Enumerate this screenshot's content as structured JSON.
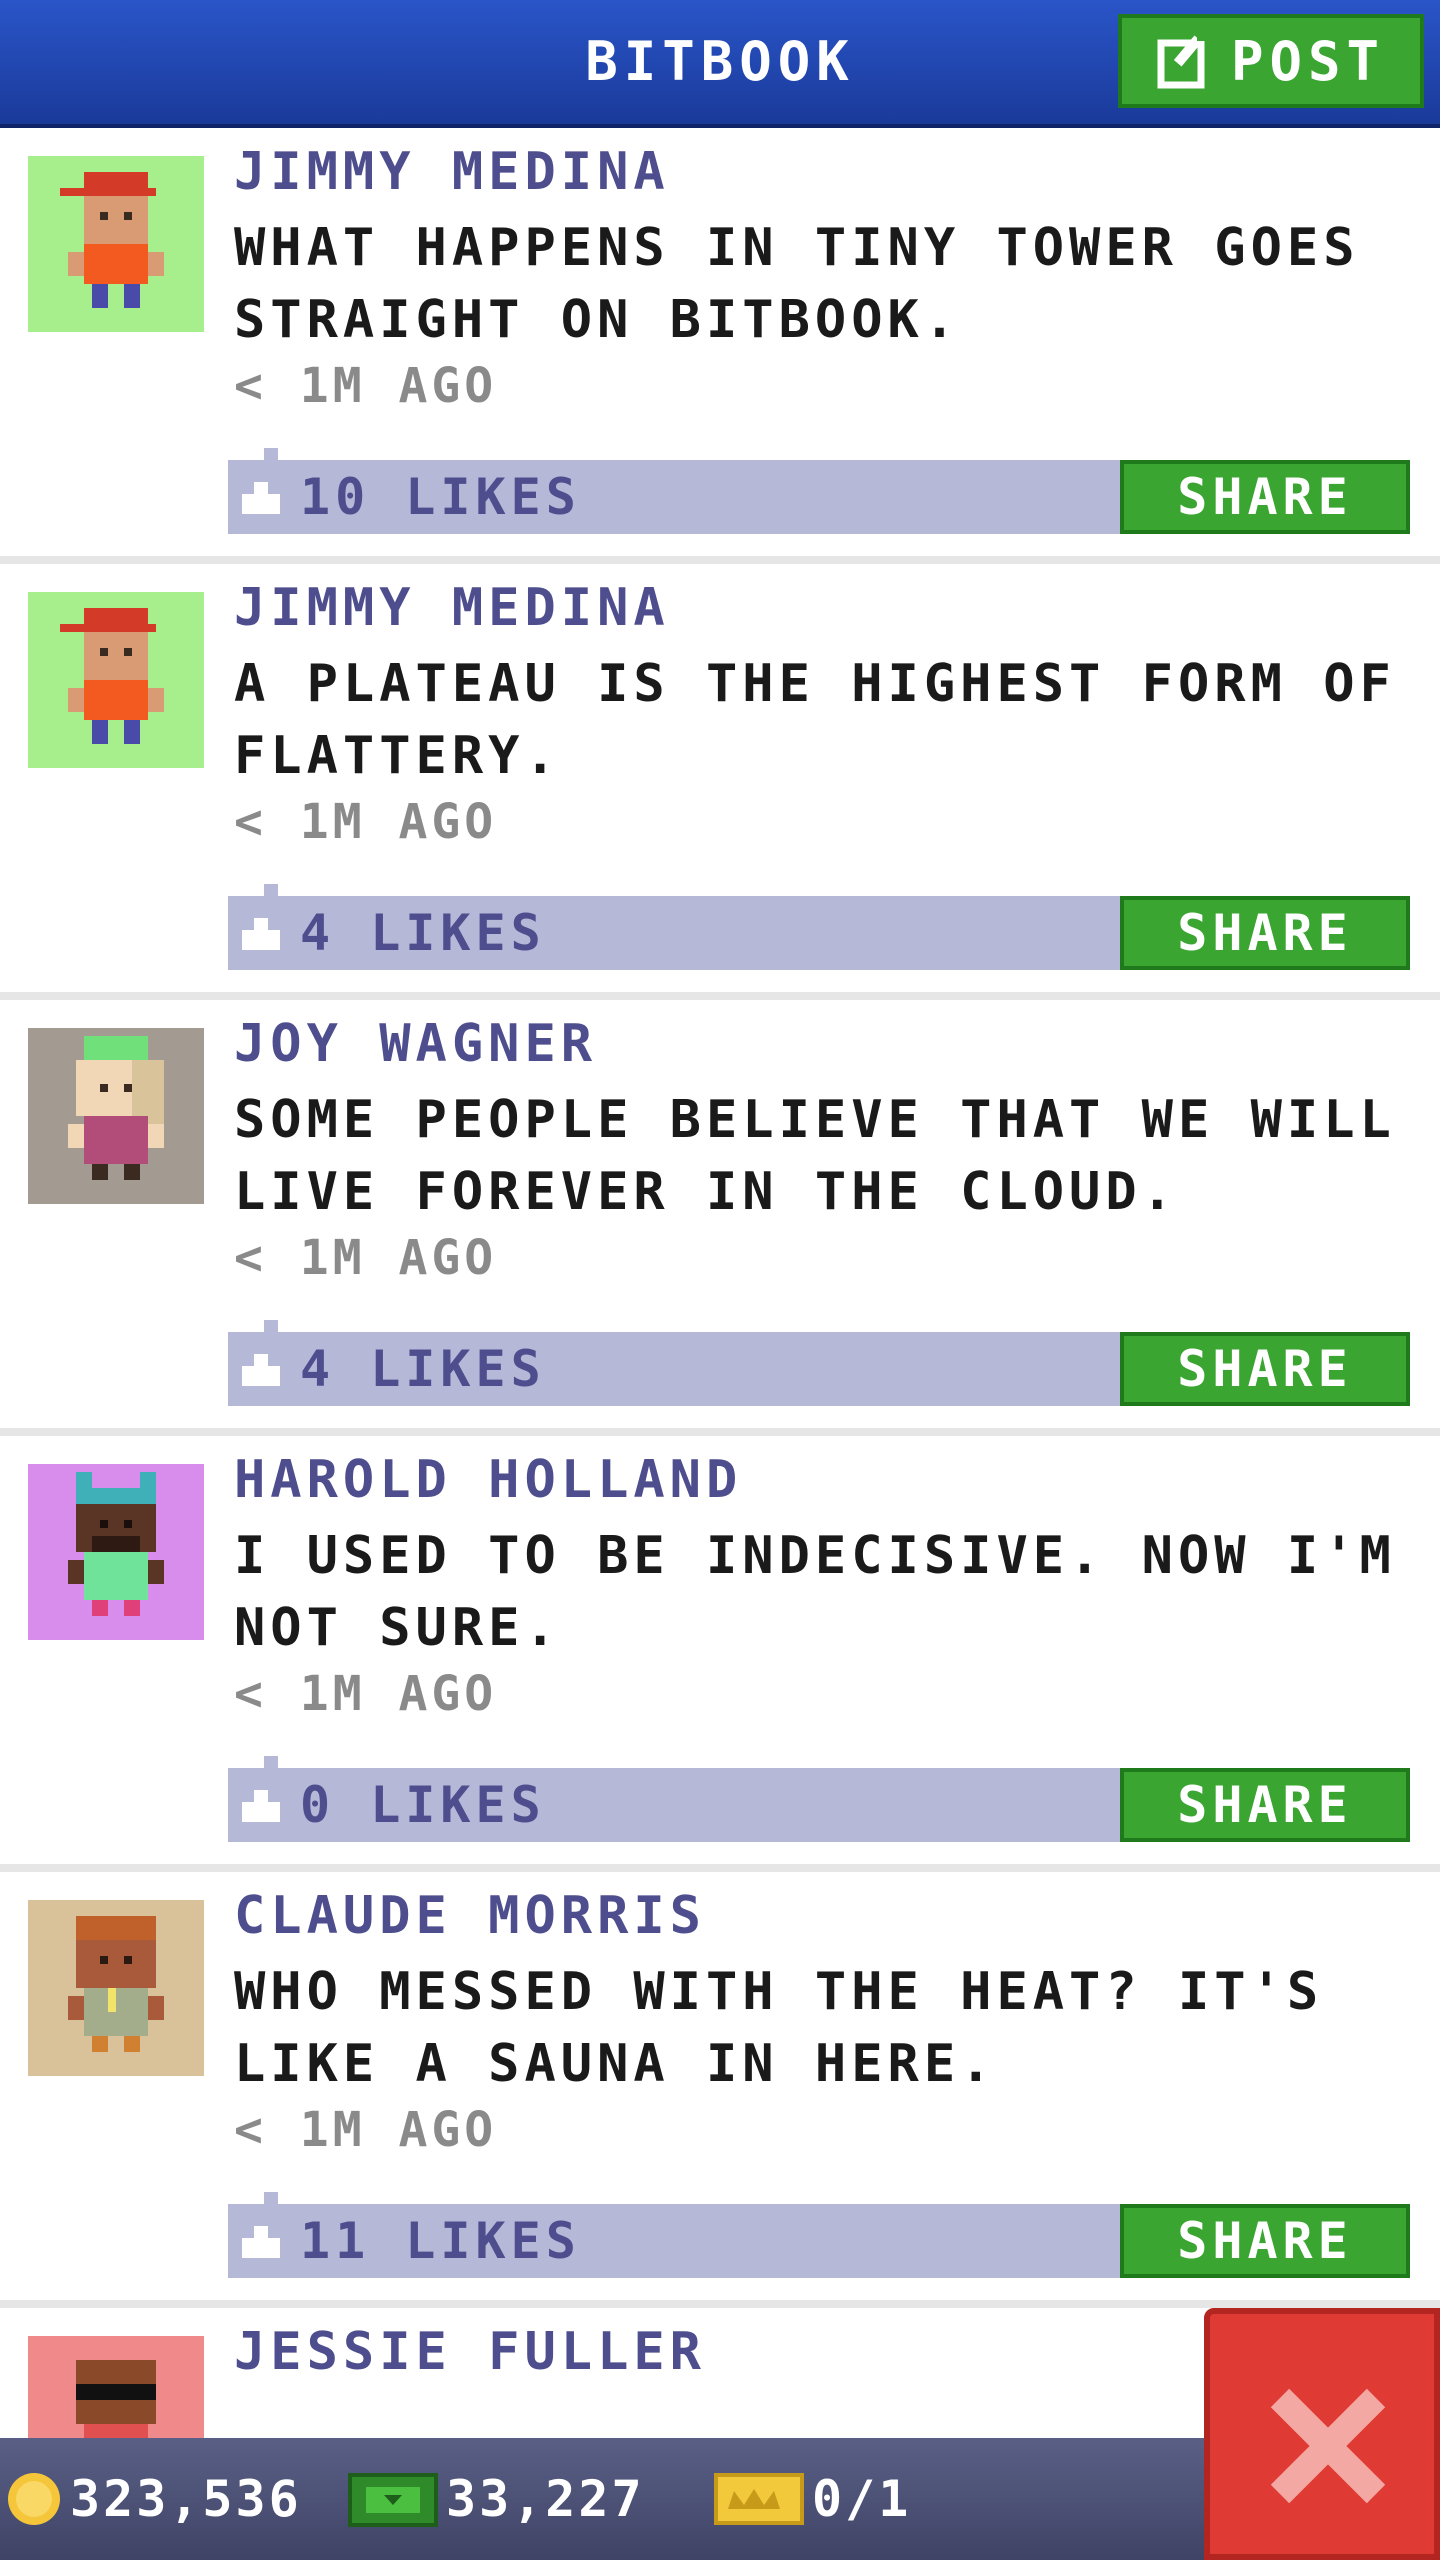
{
  "header": {
    "title": "BITBOOK",
    "post_label": "POST"
  },
  "posts": [
    {
      "author": "JIMMY MEDINA",
      "message": "WHAT HAPPENS IN TINY TOWER GOES STRAIGHT ON BITBOOK.",
      "time": "< 1M AGO",
      "likes": "10 LIKES",
      "share_label": "SHARE"
    },
    {
      "author": "JIMMY MEDINA",
      "message": "A PLATEAU IS THE HIGHEST FORM OF FLATTERY.",
      "time": "< 1M AGO",
      "likes": "4 LIKES",
      "share_label": "SHARE"
    },
    {
      "author": "JOY WAGNER",
      "message": "SOME PEOPLE BELIEVE THAT WE WILL LIVE FOREVER IN THE CLOUD.",
      "time": "< 1M AGO",
      "likes": "4 LIKES",
      "share_label": "SHARE"
    },
    {
      "author": "HAROLD HOLLAND",
      "message": "I USED TO BE INDECISIVE. NOW I'M NOT SURE.",
      "time": "< 1M AGO",
      "likes": "0 LIKES",
      "share_label": "SHARE"
    },
    {
      "author": "CLAUDE MORRIS",
      "message": "WHO MESSED WITH THE HEAT? IT'S LIKE A SAUNA IN HERE.",
      "time": "< 1M AGO",
      "likes": "11 LIKES",
      "share_label": "SHARE"
    },
    {
      "author": "JESSIE FULLER"
    }
  ],
  "status_bar": {
    "coins": "323,536",
    "bux": "33,227",
    "tickets": "0/1"
  },
  "icons": {
    "post": "edit-icon",
    "like": "thumb-icon",
    "coin": "coin-icon",
    "bux": "bux-icon",
    "ticket": "ticket-icon",
    "close": "close-icon"
  },
  "colors": {
    "header": "#2a55c8",
    "green_button": "#3aa531",
    "like_bar": "#b6b8d8",
    "author": "#4e4e8e",
    "close": "#e03a34"
  }
}
